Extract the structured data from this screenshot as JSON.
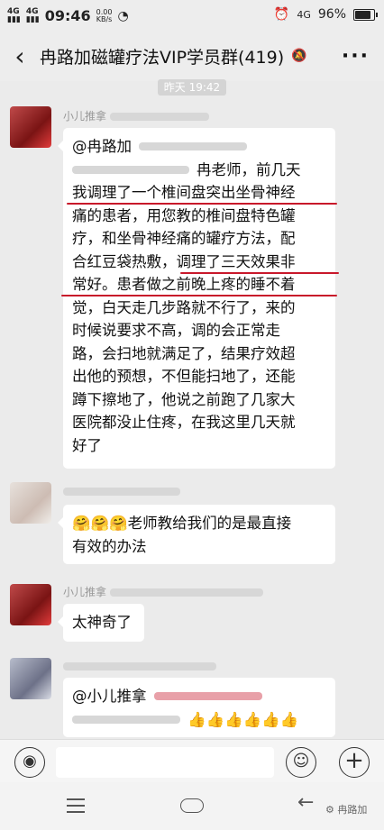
{
  "status_bar": {
    "signal1": "4G",
    "signal2": "4G",
    "time": "09:46",
    "speed": "0.00",
    "speed_unit": "KB/s",
    "network": "4G",
    "battery": "96%",
    "battery_level": 0.96
  },
  "header": {
    "back_symbol": "‹",
    "title": "冉路加磁罐疗法VIP学员群(419)",
    "more_symbol": "···"
  },
  "timestamp": "昨天 19:42",
  "messages": [
    {
      "sender": "小儿推拿",
      "mention": "@冉路加",
      "line1": "冉老师，前几天",
      "line2": "我调理了一个椎间盘突出坐骨神经",
      "line3": "痛的患者，用您教的椎间盘特色罐",
      "line4": "疗，和坐骨神经痛的罐疗方法，配",
      "line5": "合红豆袋热敷，调理了三天效果非",
      "line6": "常好。患者做之前晚上疼的睡不着",
      "line7": "觉，白天走几步路就不行了，来的",
      "line8": "时候说要求不高，调的会正常走",
      "line9": "路，会扫地就满足了，结果疗效超",
      "line10": "出他的预想，不但能扫地了，还能",
      "line11": "蹲下擦地了，他说之前跑了几家大",
      "line12": "医院都没止住疼，在我这里几天就",
      "line13": "好了"
    },
    {
      "emojis": "🤗🤗🤗",
      "line1": "老师教给我们的是最直接",
      "line2": "有效的办法"
    },
    {
      "sender": "小儿推拿",
      "text": "太神奇了"
    },
    {
      "mention": "@小儿推拿",
      "emojis": "👍👍👍👍👍👍"
    }
  ],
  "input_bar": {
    "voice_symbol": "◉",
    "emoji_symbol": "☺",
    "plus_symbol": "+"
  },
  "nav_bar": {
    "back_symbol": "←",
    "watermark": "冉路加"
  }
}
